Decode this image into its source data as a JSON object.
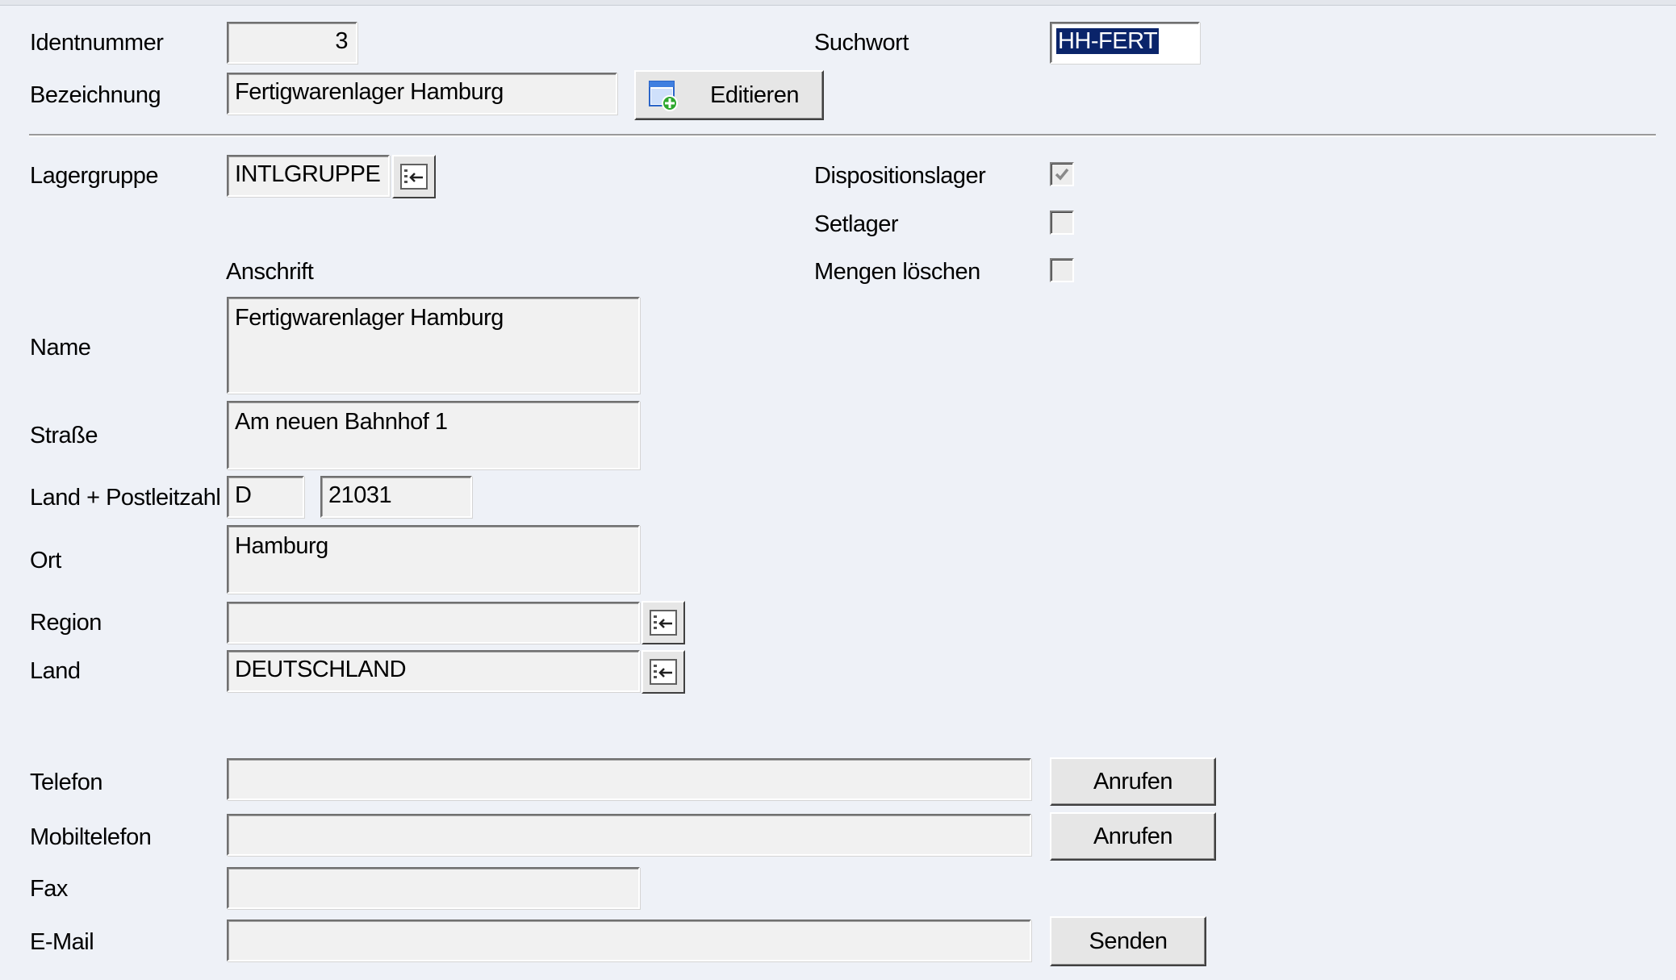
{
  "header": {
    "identnummer_label": "Identnummer",
    "identnummer_value": "3",
    "bezeichnung_label": "Bezeichnung",
    "bezeichnung_value": "Fertigwarenlager Hamburg",
    "edit_button_label": "Editieren",
    "suchwort_label": "Suchwort",
    "suchwort_value": "HH-FERT"
  },
  "general": {
    "lagergruppe_label": "Lagergruppe",
    "lagergruppe_value": "INTLGRUPPE",
    "dispositionslager_label": "Dispositionslager",
    "dispositionslager_checked": true,
    "setlager_label": "Setlager",
    "setlager_checked": false,
    "mengen_loeschen_label": "Mengen löschen",
    "mengen_loeschen_checked": false
  },
  "address": {
    "section_label": "Anschrift",
    "name_label": "Name",
    "name_value": "Fertigwarenlager Hamburg",
    "strasse_label": "Straße",
    "strasse_value": "Am neuen Bahnhof 1",
    "land_plz_label": "Land + Postleitzahl",
    "land_code_value": "D",
    "plz_value": "21031",
    "ort_label": "Ort",
    "ort_value": "Hamburg",
    "region_label": "Region",
    "region_value": "",
    "land_label": "Land",
    "land_value": "DEUTSCHLAND"
  },
  "contact": {
    "telefon_label": "Telefon",
    "telefon_value": "",
    "telefon_button": "Anrufen",
    "mobil_label": "Mobiltelefon",
    "mobil_value": "",
    "mobil_button": "Anrufen",
    "fax_label": "Fax",
    "fax_value": "",
    "email_label": "E-Mail",
    "email_value": "",
    "email_button": "Senden"
  },
  "colors": {
    "background": "#eef1f7",
    "field_background": "#f1f1f1",
    "selection": "#0a246a"
  }
}
